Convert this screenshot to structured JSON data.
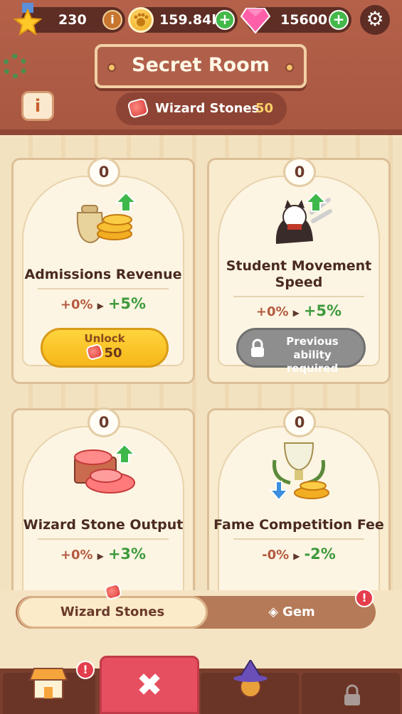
{
  "header": {
    "level_value": "230",
    "coins_value": "159.84k",
    "gems_value": "15600",
    "title": "Secret Room",
    "wizard_stones_label": "Wizard Stones",
    "wizard_stones_count": "50",
    "info_label": "i"
  },
  "cards": [
    {
      "level": "0",
      "name": "Admissions Revenue",
      "current": "+0%",
      "next": "+5%",
      "button_line1": "Unlock",
      "button_line2": "50"
    },
    {
      "level": "0",
      "name_line1": "Student Movement",
      "name_line2": "Speed",
      "current": "+0%",
      "next": "+5%",
      "button_line1": "Previous",
      "button_line2": "ability required"
    },
    {
      "level": "0",
      "name": "Wizard Stone Output",
      "current": "+0%",
      "next": "+3%"
    },
    {
      "level": "0",
      "name": "Fame Competition Fee",
      "current": "-0%",
      "next": "-2%"
    }
  ],
  "tabs": {
    "active": "Wizard Stones",
    "other": "Gem",
    "alert": "!"
  },
  "nav": {
    "shop_alert": "!"
  },
  "colors": {
    "accent_green": "#3e9a3c",
    "accent_red": "#e64f60",
    "header_brown": "#b5614a"
  }
}
